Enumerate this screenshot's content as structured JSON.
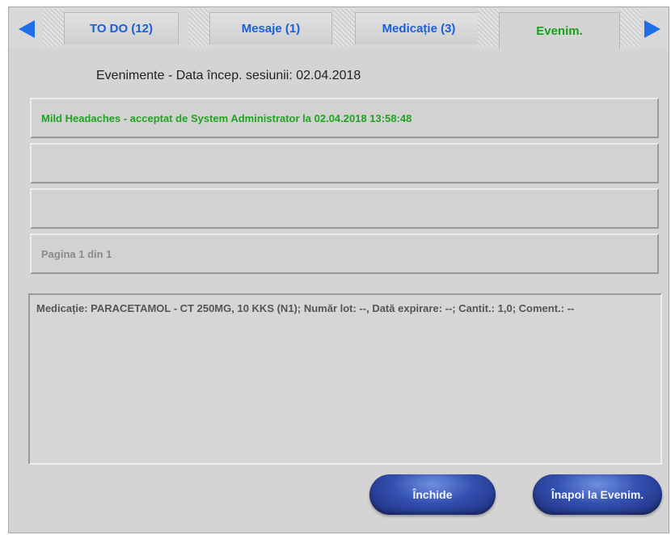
{
  "tabs": [
    {
      "label": "TO DO (12)"
    },
    {
      "label": "Mesaje (1)"
    },
    {
      "label": "Medicație (3)"
    },
    {
      "label": "Evenim."
    }
  ],
  "active_tab": "Evenim.",
  "colors": {
    "tab_text": "#1a5fd8",
    "active_tab_text": "#19a019",
    "event_text": "#1ea41e",
    "arrow": "#1e6ee8"
  },
  "icons": {
    "left": "arrow-left-icon",
    "right": "arrow-right-icon"
  },
  "header": {
    "title": "Evenimente - Data încep. sesiunii: 02.04.2018"
  },
  "events": [
    {
      "text": "Mild Headaches - acceptat de System Administrator la 02.04.2018 13:58:48"
    },
    {
      "text": ""
    },
    {
      "text": ""
    }
  ],
  "pager": {
    "text": "Pagina 1 din 1"
  },
  "detail": {
    "text": "Medicație: PARACETAMOL - CT 250MG, 10 KKS (N1); Număr lot: --, Dată expirare: --; Cantit.: 1,0; Coment.: --"
  },
  "buttons": {
    "close": "Închide",
    "back": "Înapoi la Evenim."
  }
}
